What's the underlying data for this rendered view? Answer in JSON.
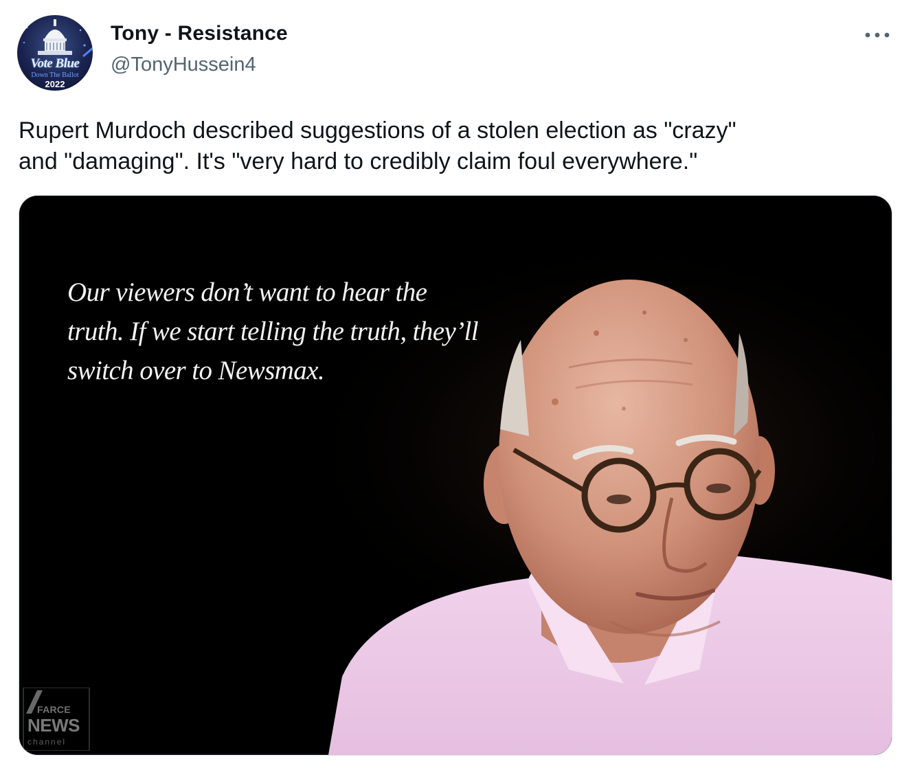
{
  "author": {
    "display_name": "Tony - Resistance",
    "handle": "@TonyHussein4",
    "avatar": {
      "line1": "Vote Blue",
      "line2": "Down The Ballot",
      "year": "2022"
    }
  },
  "more_icon": "ellipsis-icon",
  "tweet": {
    "text": "Rupert Murdoch described suggestions of a stolen election as \"crazy\"\nand \"damaging\". It's \"very hard to credibly claim foul everywhere.\""
  },
  "media": {
    "quote": "Our viewers don’t want to hear the truth. If we start telling the truth, they’ll switch over to Newsmax.",
    "logo": {
      "top": "FARCE",
      "middle": "NEWS",
      "bottom": "channel"
    }
  },
  "colors": {
    "text": "#0f1419",
    "secondary": "#536471",
    "border": "#cfd9de",
    "shirt": "#eecbe6"
  }
}
